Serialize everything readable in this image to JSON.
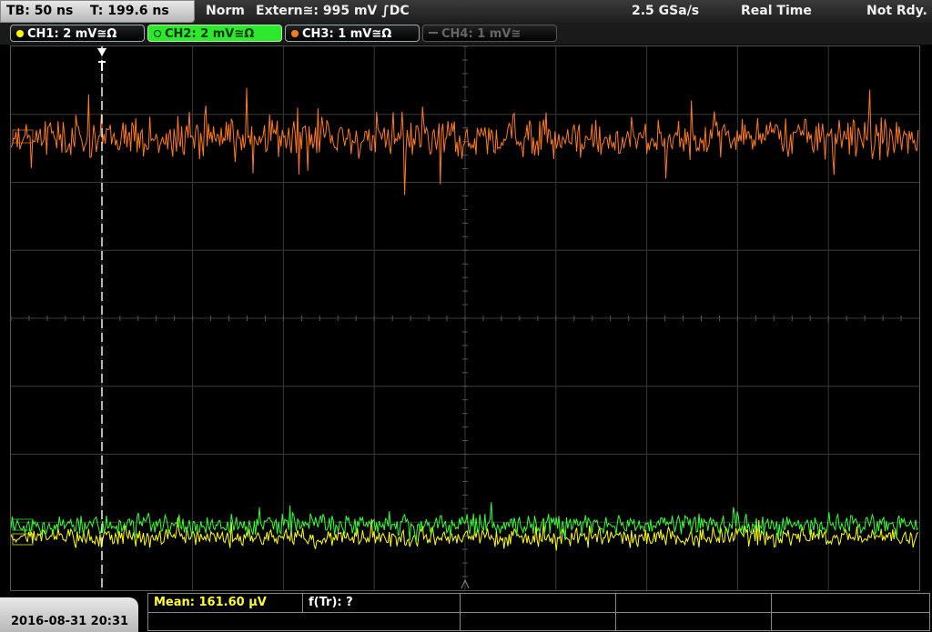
{
  "status": {
    "timebase": "TB: 50 ns",
    "trigger_time": "T: 199.6 ns",
    "mode": "Norm",
    "trigger_source": "Extern≅: 995 mV ∫DC",
    "sample_rate": "2.5 GSa/s",
    "acq_mode": "Real Time",
    "run_state": "Not Rdy."
  },
  "channels": [
    {
      "label": "CH1: 2 mV≅Ω",
      "color": "#ffff00",
      "state": "on"
    },
    {
      "label": "CH2: 2 mV≅Ω",
      "color": "#33ff33",
      "state": "active"
    },
    {
      "label": "CH3: 1 mV≅Ω",
      "color": "#ff7a1a",
      "state": "on"
    },
    {
      "label": "CH4: 1 mV≅",
      "color": "#666666",
      "state": "off"
    }
  ],
  "colors": {
    "ch1": "#ffff00",
    "ch2": "#33ff33",
    "ch3": "#ff7a1a",
    "grid": "#3a3a3a",
    "cursor": "#ffffff"
  },
  "measurements": {
    "mean": "Mean: 161.60 µV",
    "ftr": "f(Tr): ?"
  },
  "datetime": "2016-08-31 20:31"
}
